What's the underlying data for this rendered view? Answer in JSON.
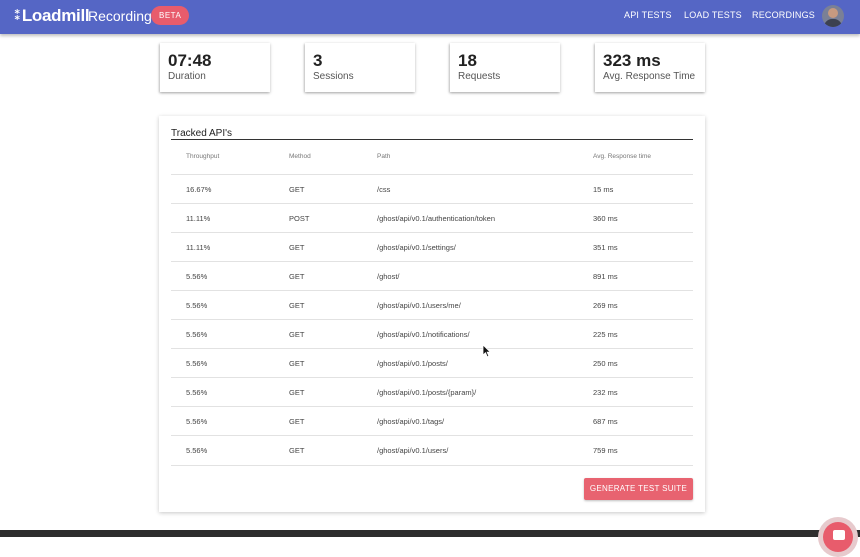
{
  "header": {
    "logo_text": "Loadmill",
    "logo_mark": "⁑",
    "app_title": "Recording",
    "badge": "BETA",
    "nav": [
      "API TESTS",
      "LOAD TESTS",
      "RECORDINGS"
    ]
  },
  "stats": [
    {
      "value": "07:48",
      "label": "Duration"
    },
    {
      "value": "3",
      "label": "Sessions"
    },
    {
      "value": "18",
      "label": "Requests"
    },
    {
      "value": "323 ms",
      "label": "Avg. Response Time"
    }
  ],
  "tracked": {
    "title": "Tracked API's",
    "columns": [
      "Throughput",
      "Method",
      "Path",
      "Avg. Response time"
    ],
    "rows": [
      {
        "throughput": "16.67%",
        "method": "GET",
        "path": "/css",
        "avg": "15 ms"
      },
      {
        "throughput": "11.11%",
        "method": "POST",
        "path": "/ghost/api/v0.1/authentication/token",
        "avg": "360 ms"
      },
      {
        "throughput": "11.11%",
        "method": "GET",
        "path": "/ghost/api/v0.1/settings/",
        "avg": "351 ms"
      },
      {
        "throughput": "5.56%",
        "method": "GET",
        "path": "/ghost/",
        "avg": "891 ms"
      },
      {
        "throughput": "5.56%",
        "method": "GET",
        "path": "/ghost/api/v0.1/users/me/",
        "avg": "269 ms"
      },
      {
        "throughput": "5.56%",
        "method": "GET",
        "path": "/ghost/api/v0.1/notifications/",
        "avg": "225 ms"
      },
      {
        "throughput": "5.56%",
        "method": "GET",
        "path": "/ghost/api/v0.1/posts/",
        "avg": "250 ms"
      },
      {
        "throughput": "5.56%",
        "method": "GET",
        "path": "/ghost/api/v0.1/posts/{param}/",
        "avg": "232 ms"
      },
      {
        "throughput": "5.56%",
        "method": "GET",
        "path": "/ghost/api/v0.1/tags/",
        "avg": "687 ms"
      },
      {
        "throughput": "5.56%",
        "method": "GET",
        "path": "/ghost/api/v0.1/users/",
        "avg": "759 ms"
      }
    ],
    "generate_label": "GENERATE TEST SUITE"
  },
  "colors": {
    "header_bg": "#5566c5",
    "accent": "#e86370"
  },
  "icons": {
    "avatar": "user-avatar",
    "cursor": "mouse-pointer-icon",
    "chat": "chat-icon"
  }
}
